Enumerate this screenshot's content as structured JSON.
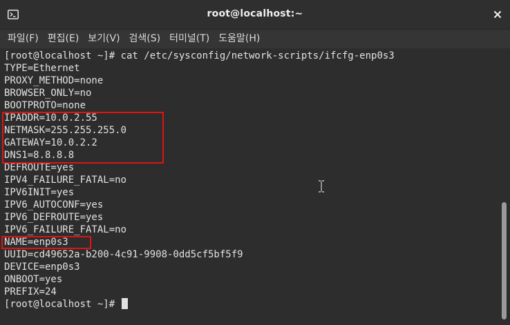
{
  "window": {
    "title": "root@localhost:~",
    "close_glyph": "✕"
  },
  "menubar": {
    "items": [
      {
        "label": "파일(F)"
      },
      {
        "label": "편집(E)"
      },
      {
        "label": "보기(V)"
      },
      {
        "label": "검색(S)"
      },
      {
        "label": "터미널(T)"
      },
      {
        "label": "도움말(H)"
      }
    ]
  },
  "terminal": {
    "lines": [
      "[root@localhost ~]# cat /etc/sysconfig/network-scripts/ifcfg-enp0s3",
      "TYPE=Ethernet",
      "PROXY_METHOD=none",
      "BROWSER_ONLY=no",
      "BOOTPROTO=none",
      "IPADDR=10.0.2.55",
      "NETMASK=255.255.255.0",
      "GATEWAY=10.0.2.2",
      "DNS1=8.8.8.8",
      "DEFROUTE=yes",
      "IPV4_FAILURE_FATAL=no",
      "IPV6INIT=yes",
      "IPV6_AUTOCONF=yes",
      "IPV6_DEFROUTE=yes",
      "IPV6_FAILURE_FATAL=no",
      "NAME=enp0s3",
      "UUID=cd49652a-b200-4c91-9908-0dd5cf5bf5f9",
      "DEVICE=enp0s3",
      "ONBOOT=yes",
      "PREFIX=24"
    ],
    "prompt": "[root@localhost ~]# "
  },
  "colors": {
    "background": "#2d2d2d",
    "text": "#e2e2e2",
    "highlight": "#e01414",
    "titlebar": "#2f2f2f",
    "menubar": "#353535"
  },
  "icons": {
    "title": "terminal-icon",
    "close": "close-icon",
    "pointer": "ibeam-cursor-icon"
  }
}
